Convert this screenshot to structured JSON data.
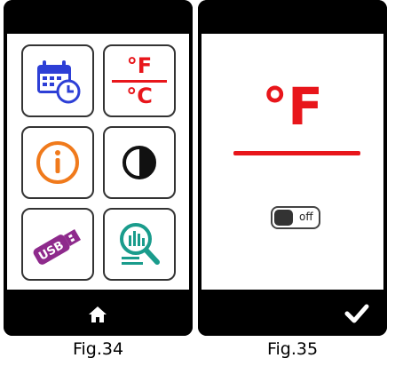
{
  "fig34": {
    "caption": "Fig.34",
    "tiles": [
      {
        "name": "calendar-clock-icon",
        "color": "#2d3fd6"
      },
      {
        "name": "fahrenheit-celsius-icon",
        "color": "#e8161b",
        "top": "°F",
        "bottom": "°C"
      },
      {
        "name": "info-icon",
        "color": "#f07a1c"
      },
      {
        "name": "contrast-icon",
        "color": "#111111"
      },
      {
        "name": "usb-icon",
        "color": "#8e2a8c",
        "text": "USB"
      },
      {
        "name": "data-search-icon",
        "color": "#1a9c8c"
      }
    ],
    "bottom_icon": "home-icon"
  },
  "fig35": {
    "caption": "Fig.35",
    "unit": "°F",
    "unit_color": "#e8161b",
    "toggle_label": "off",
    "toggle_state": false,
    "bottom_icon": "check-icon"
  }
}
